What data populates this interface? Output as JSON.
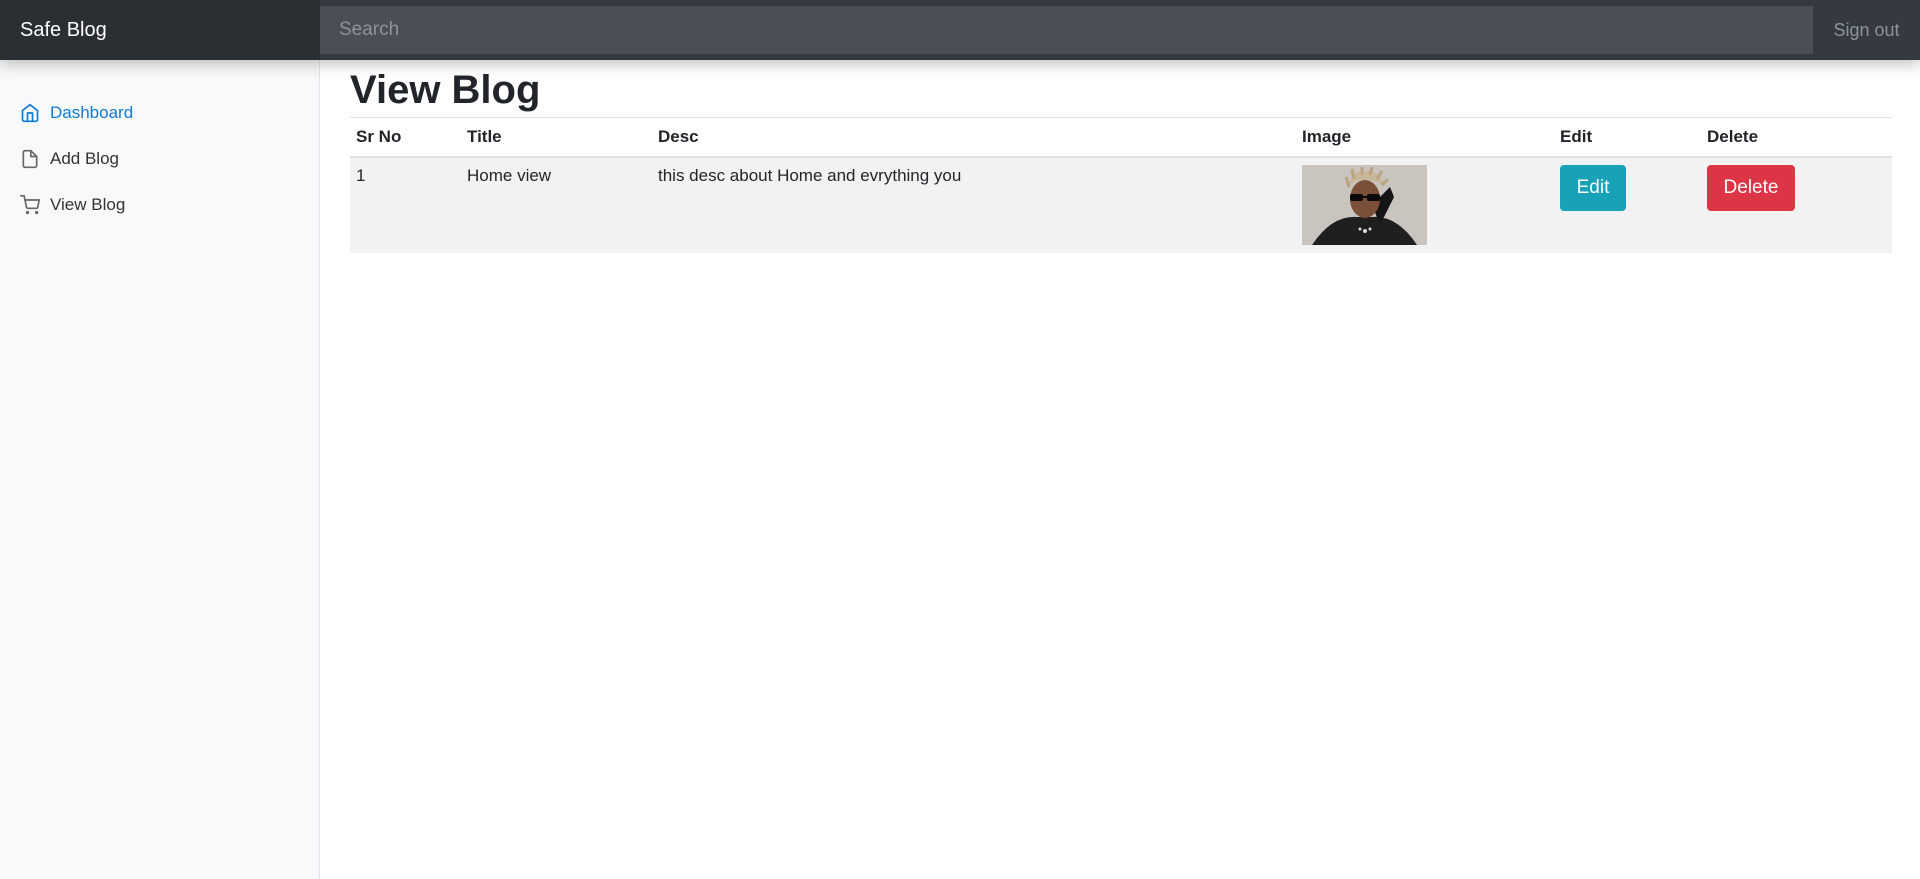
{
  "navbar": {
    "brand": "Safe Blog",
    "search_placeholder": "Search",
    "signout_label": "Sign out"
  },
  "sidebar": {
    "items": [
      {
        "label": "Dashboard",
        "icon": "home-icon",
        "active": true
      },
      {
        "label": "Add Blog",
        "icon": "file-icon",
        "active": false
      },
      {
        "label": "View Blog",
        "icon": "cart-icon",
        "active": false
      }
    ]
  },
  "main": {
    "title": "View Blog",
    "table": {
      "headers": [
        "Sr No",
        "Title",
        "Desc",
        "Image",
        "Edit",
        "Delete"
      ],
      "rows": [
        {
          "sr_no": "1",
          "title": "Home view",
          "desc": "this desc about Home and evrything you",
          "edit_label": "Edit",
          "delete_label": "Delete"
        }
      ]
    }
  },
  "colors": {
    "navbar_bg": "#343a40",
    "active_link": "#0d7bd6",
    "edit_button": "#17a2b8",
    "delete_button": "#dc3545"
  }
}
